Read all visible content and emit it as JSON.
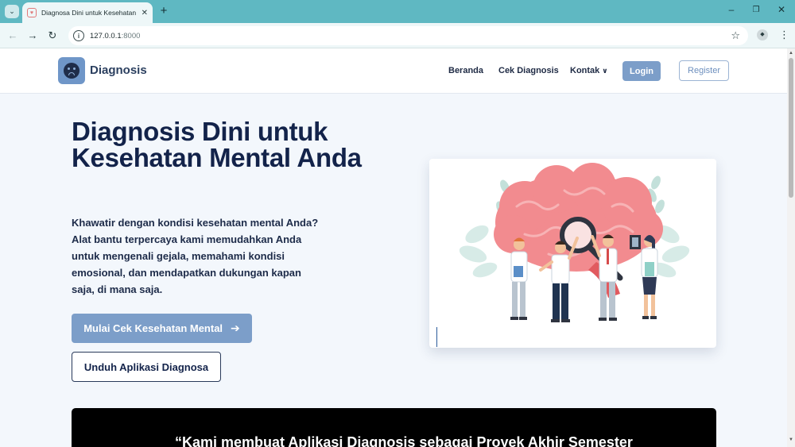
{
  "browser": {
    "tab_title": "Diagnosa Dini untuk Kesehatan M",
    "url_host": "127.0.0.1",
    "url_port": ":8000"
  },
  "navbar": {
    "brand": "Diagnosis",
    "links": [
      "Beranda",
      "Cek Diagnosis",
      "Kontak"
    ],
    "login_label": "Login",
    "register_label": "Register"
  },
  "hero": {
    "title": "Diagnosis Dini untuk Kesehatan Mental Anda",
    "description": "Khawatir dengan kondisi kesehatan mental Anda? Alat bantu terpercaya kami memudahkan Anda untuk mengenali gejala, memahami kondisi emosional, dan mendapatkan dukungan kapan saja, di mana saja.",
    "primary_button": "Mulai Cek Kesehatan Mental",
    "secondary_button": "Unduh Aplikasi Diagnosa"
  },
  "quote": {
    "text": "“Kami membuat Aplikasi Diagnosis sebagai Proyek Akhir Semester"
  },
  "icons": {
    "logo": "sad-face-icon",
    "arrow": "arrow-right-icon",
    "chevron": "chevron-down-icon"
  },
  "colors": {
    "accent": "#7c9ec9",
    "heading": "#13234a",
    "brand_text": "#2b3f5f"
  }
}
